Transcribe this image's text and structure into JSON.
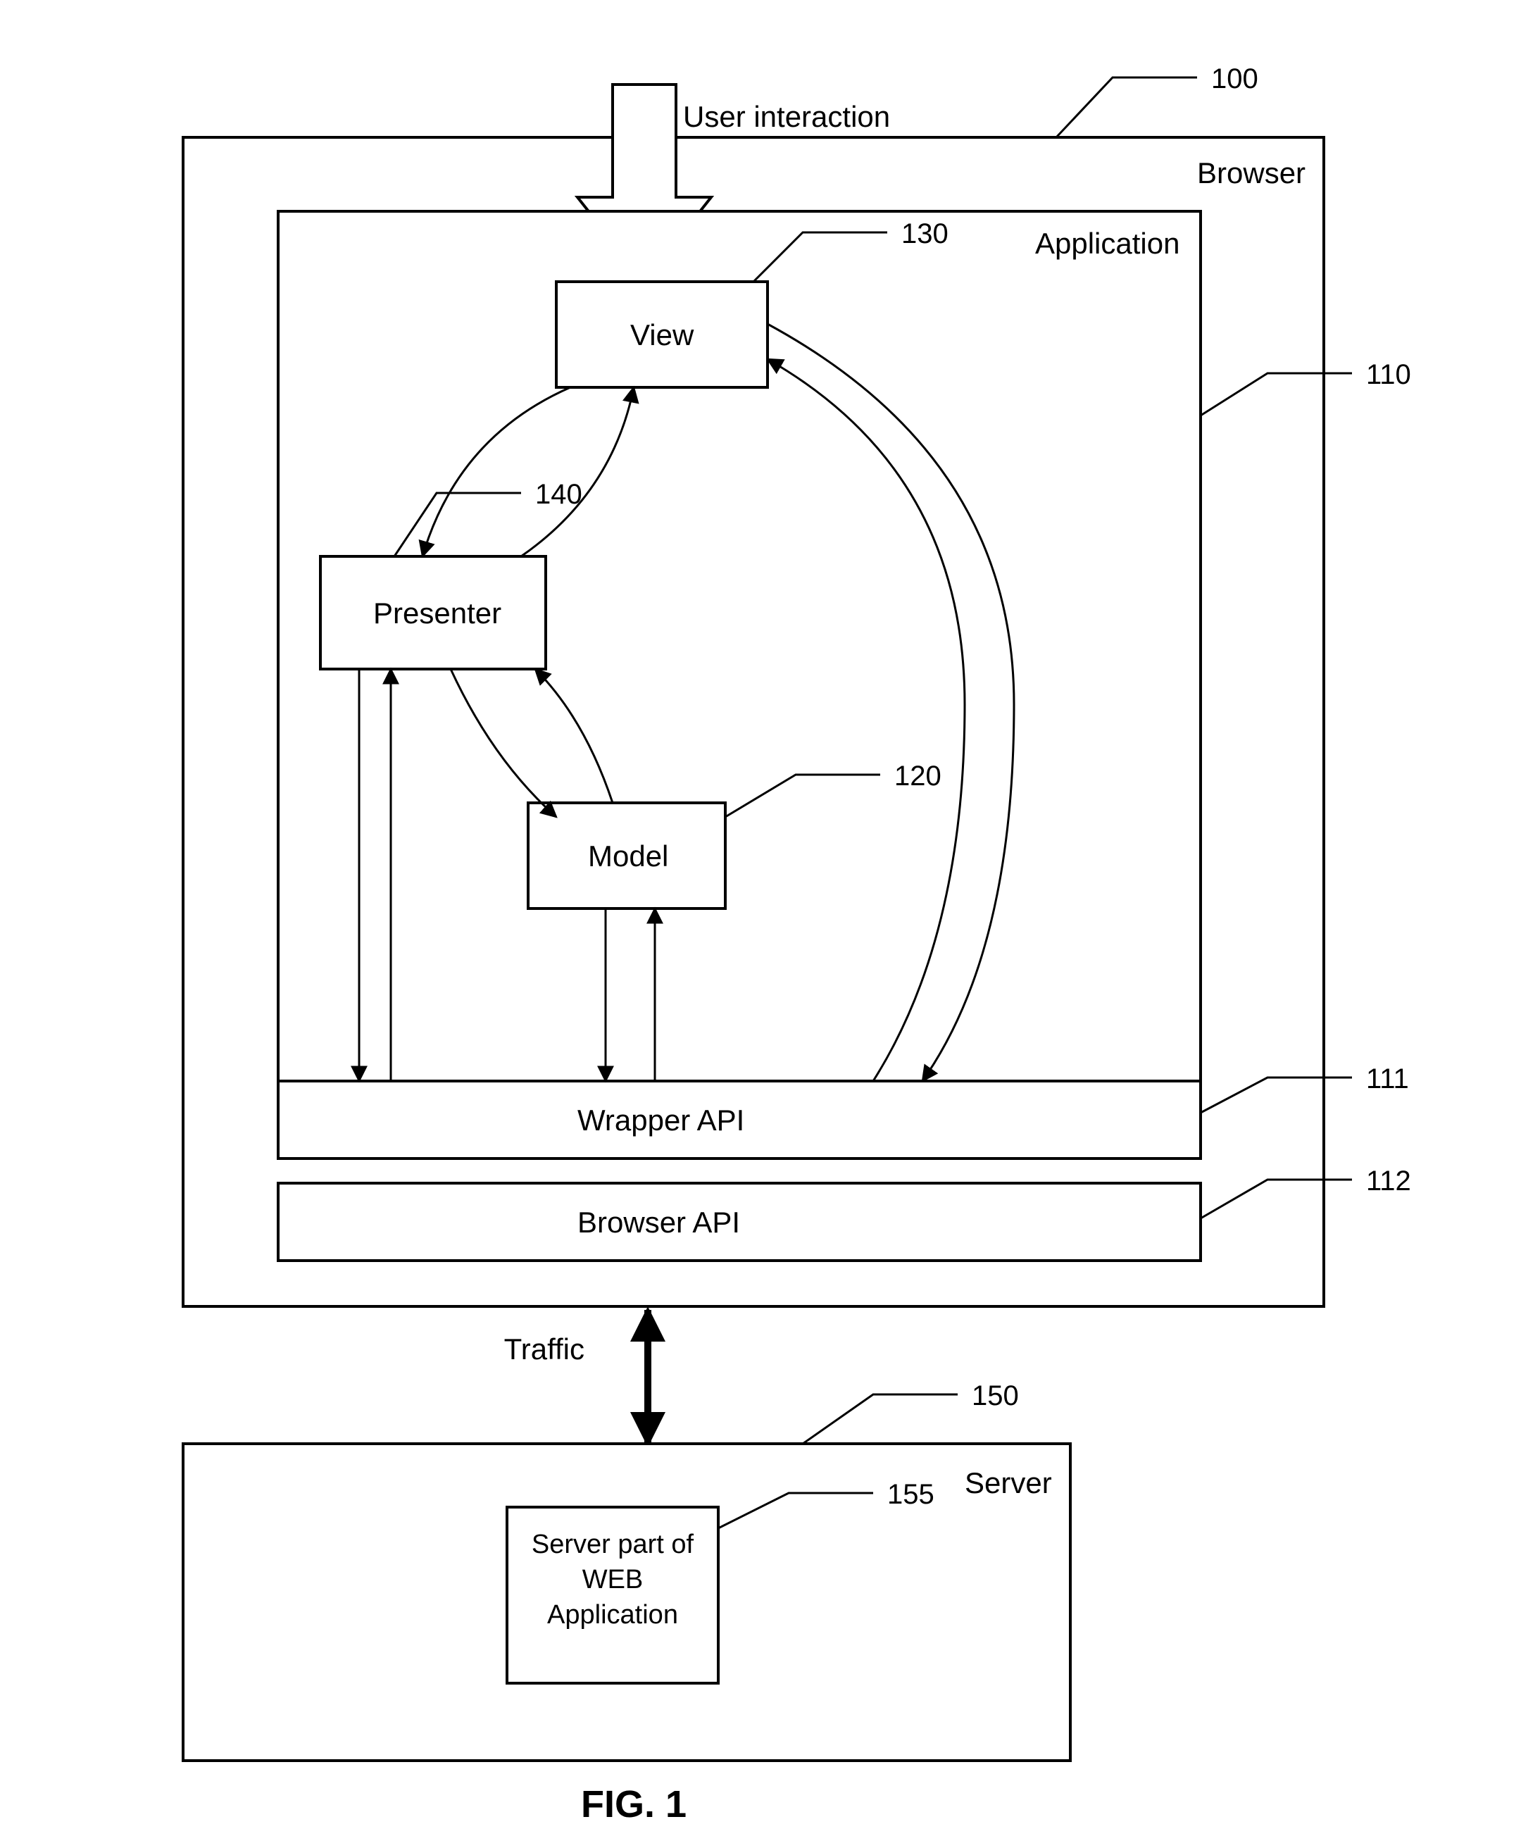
{
  "labels": {
    "user_interaction": "User interaction",
    "browser": "Browser",
    "application": "Application",
    "view": "View",
    "presenter": "Presenter",
    "model": "Model",
    "wrapper_api": "Wrapper API",
    "browser_api": "Browser API",
    "traffic": "Traffic",
    "server": "Server",
    "server_part": "Server part of\nWEB\nApplication",
    "fig": "FIG. 1"
  },
  "refs": {
    "browser": "100",
    "application": "110",
    "wrapper_api": "111",
    "browser_api": "112",
    "model": "120",
    "view": "130",
    "presenter": "140",
    "server": "150",
    "server_part": "155"
  }
}
